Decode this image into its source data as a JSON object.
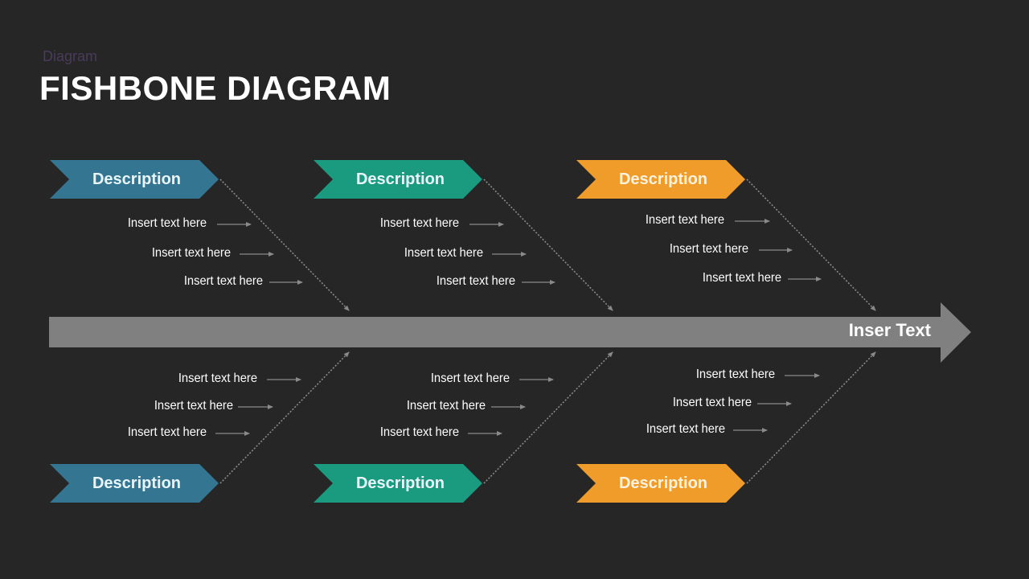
{
  "header": {
    "subtitle": "Diagram",
    "title": "FISHBONE DIAGRAM"
  },
  "spine": {
    "label": "Inser Text",
    "color": "#808080"
  },
  "colors": {
    "background": "#262626",
    "blue": "#347591",
    "green": "#1a9a7f",
    "orange": "#ef9c2b",
    "connector": "#8a8a8a"
  },
  "categories": [
    {
      "position": "top",
      "color_name": "blue",
      "label": "Description",
      "items": [
        "Insert text here",
        "Insert text here",
        "Insert text here"
      ]
    },
    {
      "position": "top",
      "color_name": "green",
      "label": "Description",
      "items": [
        "Insert text here",
        "Insert text here",
        "Insert text here"
      ]
    },
    {
      "position": "top",
      "color_name": "orange",
      "label": "Description",
      "items": [
        "Insert text here",
        "Insert text here",
        "Insert text here"
      ]
    },
    {
      "position": "bottom",
      "color_name": "blue",
      "label": "Description",
      "items": [
        "Insert text here",
        "Insert text here",
        "Insert text here"
      ]
    },
    {
      "position": "bottom",
      "color_name": "green",
      "label": "Description",
      "items": [
        "Insert text here",
        "Insert text here",
        "Insert text here"
      ]
    },
    {
      "position": "bottom",
      "color_name": "orange",
      "label": "Description",
      "items": [
        "Insert text here",
        "Insert text here",
        "Insert text here"
      ]
    }
  ]
}
